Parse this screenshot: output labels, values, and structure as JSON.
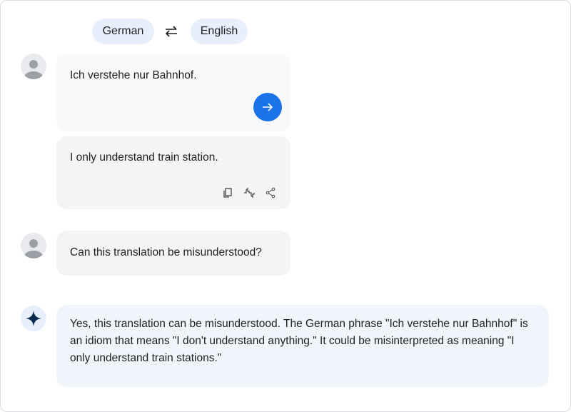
{
  "languages": {
    "source": "German",
    "target": "English"
  },
  "messages": [
    {
      "role": "user",
      "text": "Ich verstehe nur Bahnhof."
    },
    {
      "role": "translation",
      "text": "I only understand train station."
    },
    {
      "role": "user",
      "text": "Can this translation be misunderstood?"
    },
    {
      "role": "assistant",
      "text": "Yes, this translation can be misunderstood. The German phrase \"Ich verstehe nur Bahnhof\" is an idiom that means \"I don't understand anything.\" It could be misinterpreted as meaning \"I only understand train stations.\""
    }
  ],
  "colors": {
    "accent": "#1a73e8",
    "chip": "#e8effc",
    "bubble": "#f8f9fa",
    "translation_bubble": "#f4f4f5",
    "assistant_bubble": "#f0f4fb",
    "star": "#0b2a4f"
  },
  "icons": [
    "avatar-icon",
    "swap-icon",
    "send-arrow-icon",
    "copy-icon",
    "thumbs-up-down-icon",
    "share-icon",
    "sparkle-icon"
  ]
}
